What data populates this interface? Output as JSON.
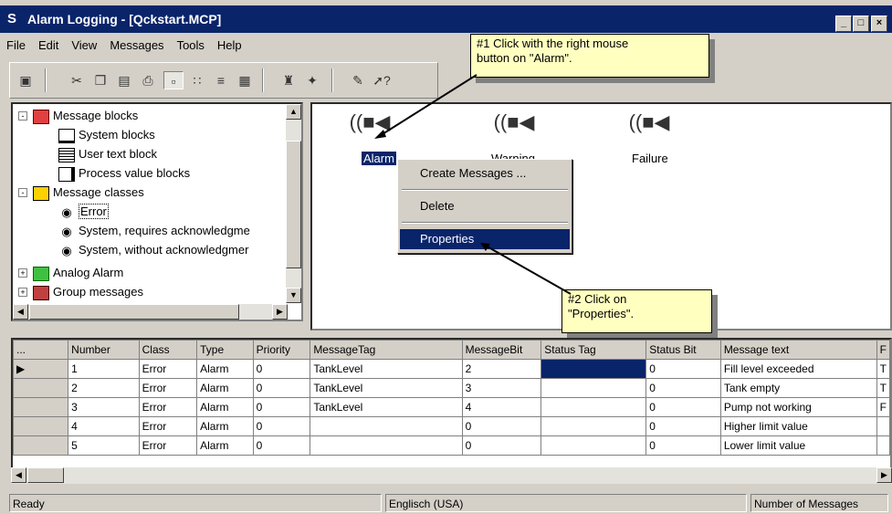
{
  "window": {
    "title": "Alarm Logging - [Qckstart.MCP]",
    "min": "_",
    "max": "□",
    "close": "×"
  },
  "menu": [
    "File",
    "Edit",
    "View",
    "Messages",
    "Tools",
    "Help"
  ],
  "tree": {
    "message_blocks": "Message blocks",
    "system_blocks": "System blocks",
    "user_text_block": "User text block",
    "process_value_blocks": "Process value blocks",
    "message_classes": "Message classes",
    "error": "Error",
    "sys_req_ack": "System, requires acknowledgme",
    "sys_without_ack": "System, without acknowledgmer",
    "analog_alarm": "Analog Alarm",
    "group_messages": "Group messages"
  },
  "icons": {
    "alarm": "Alarm",
    "warning": "Warning",
    "failure": "Failure"
  },
  "context_menu": {
    "create": "Create Messages ...",
    "delete": "Delete",
    "properties": "Properties"
  },
  "callouts": {
    "note1_line1": "#1 Click with the right mouse",
    "note1_line2": "button on \"Alarm\".",
    "note2_line1": "#2 Click on",
    "note2_line2": "\"Properties\"."
  },
  "table": {
    "columns": [
      "...",
      "Number",
      "Class",
      "Type",
      "Priority",
      "MessageTag",
      "MessageBit",
      "Status Tag",
      "Status Bit",
      "Message text",
      "F"
    ],
    "rows": [
      [
        "1",
        "Error",
        "Alarm",
        "0",
        "TankLevel",
        "2",
        "",
        "0",
        "Fill level exceeded",
        "T"
      ],
      [
        "2",
        "Error",
        "Alarm",
        "0",
        "TankLevel",
        "3",
        "",
        "0",
        "Tank empty",
        "T"
      ],
      [
        "3",
        "Error",
        "Alarm",
        "0",
        "TankLevel",
        "4",
        "",
        "0",
        "Pump not working",
        "F"
      ],
      [
        "4",
        "Error",
        "Alarm",
        "0",
        "",
        "0",
        "",
        "0",
        "Higher limit value",
        ""
      ],
      [
        "5",
        "Error",
        "Alarm",
        "0",
        "",
        "0",
        "",
        "0",
        "Lower limit value",
        ""
      ]
    ]
  },
  "status": {
    "ready": "Ready",
    "language": "Englisch (USA)",
    "count": "Number of Messages"
  }
}
